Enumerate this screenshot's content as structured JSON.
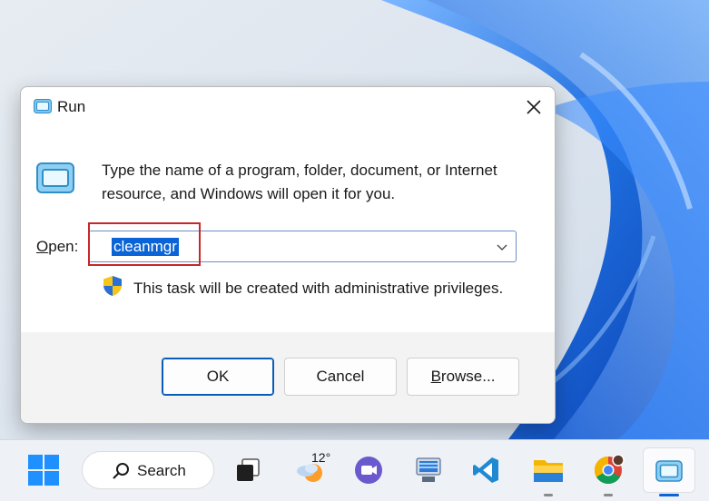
{
  "dialog": {
    "title": "Run",
    "prompt": "Type the name of a program, folder, document, or Internet resource, and Windows will open it for you.",
    "open_label_accel": "O",
    "open_label_rest": "pen:",
    "open_value": "cleanmgr",
    "admin_note": "This task will be created with administrative privileges.",
    "ok_label": "OK",
    "cancel_label": "Cancel",
    "browse_label_accel": "B",
    "browse_label_rest": "rowse..."
  },
  "taskbar": {
    "search_label": "Search",
    "weather_temp": "12°",
    "items": [
      "start-icon",
      "search-icon",
      "task-view-icon",
      "weather-icon",
      "teams-chat-icon",
      "control-panel-icon",
      "vscode-icon",
      "file-explorer-icon",
      "chrome-icon",
      "run-app-icon"
    ]
  },
  "colors": {
    "accent": "#0a64d8",
    "highlight_border": "#c62828",
    "wallpaper_blue": "#1f6fe0"
  }
}
